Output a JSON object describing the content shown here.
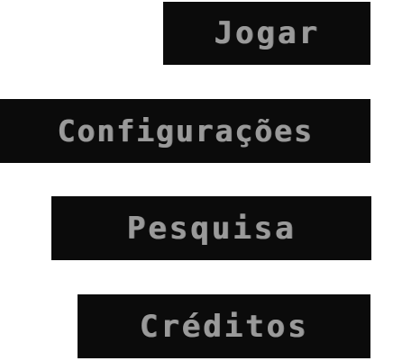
{
  "menu": {
    "play_label": "Jogar",
    "settings_label": "Configurações",
    "research_label": "Pesquisa",
    "credits_label": "Créditos"
  },
  "colors": {
    "background": "#ffffff",
    "button_bg": "#0b0b0b",
    "button_text": "#9a9a9a"
  }
}
